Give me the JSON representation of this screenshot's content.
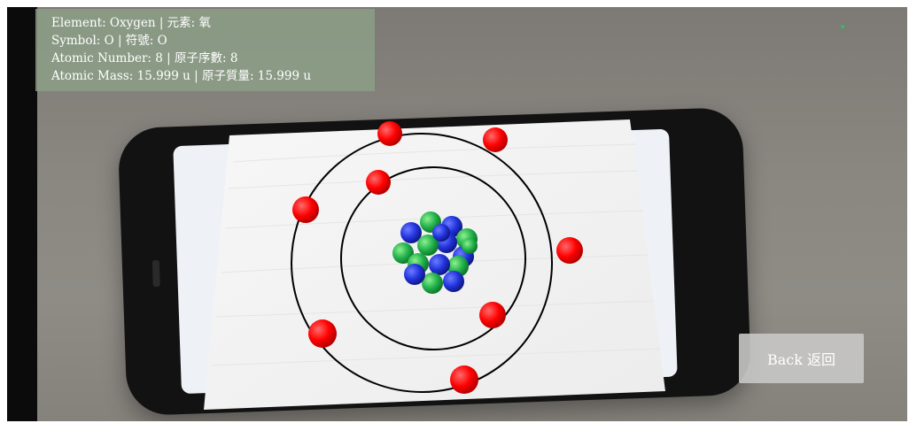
{
  "info_panel": {
    "element_line": "Element: Oxygen | 元素: 氧",
    "symbol_line": "Symbol: O | 符號: O",
    "atomic_number_line": "Atomic Number: 8 | 原子序數: 8",
    "atomic_mass_line": "Atomic Mass: 15.999 u | 原子質量: 15.999 u"
  },
  "back_button": {
    "label": "Back 返回"
  },
  "atom_model": {
    "inner_shell_electrons": 2,
    "outer_shell_electrons": 6,
    "proton_color": "#22b14c",
    "neutron_color": "#2233dd",
    "electron_color": "#ff0000"
  },
  "status_indicator_color": "#22c55e"
}
